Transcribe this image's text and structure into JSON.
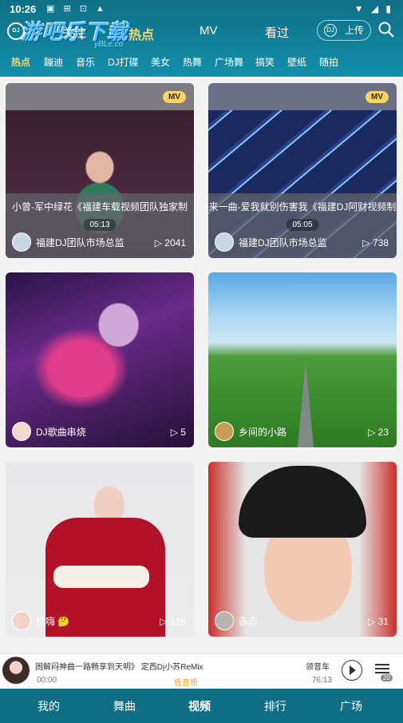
{
  "status_bar": {
    "time": "10:26",
    "icons_left": "▣ ⊞ ⊡ ▲",
    "icons_right": "▼ ◢ ▮"
  },
  "watermark": {
    "main": "游吧乐下载",
    "sub": "yBLe.co"
  },
  "header": {
    "logo": "DJ",
    "tabs": [
      {
        "label": "关注"
      },
      {
        "label": "热点"
      },
      {
        "label": "MV"
      },
      {
        "label": "看过"
      }
    ],
    "upload_label": "上传",
    "upload_icon_text": "DJ",
    "accent_color": "#f5d76e"
  },
  "categories": [
    "热点",
    "蹦迪",
    "音乐",
    "DJ打碟",
    "美女",
    "热舞",
    "广场舞",
    "搞笑",
    "壁纸",
    "随拍"
  ],
  "cards": [
    {
      "badge": "MV",
      "title": "小曾-军中绿花《福建车载视频团队独家制",
      "duration": "05:13",
      "author": "福建DJ团队市场总监",
      "plays": "2041"
    },
    {
      "badge": "MV",
      "title": "来一曲-爱我就别伤害我《福建DJ阿财视频制",
      "duration": "05:05",
      "author": "福建DJ团队市场总监",
      "plays": "738"
    },
    {
      "author": "DJ歌曲串烧",
      "plays": "5"
    },
    {
      "author": "乡间的小路",
      "plays": "23"
    },
    {
      "author": "快嗨 🤔",
      "plays": "128"
    },
    {
      "author": "赤赤",
      "plays": "31"
    }
  ],
  "player": {
    "song": "困解闷神曲一路畅享到天明》 定西Dj小苏ReMix",
    "song_tail": "领音车",
    "elapsed": "00:00",
    "quality": "低音质",
    "total": "76:13",
    "playlist_count": "20"
  },
  "bottom_nav": [
    "我的",
    "舞曲",
    "视频",
    "排行",
    "广场"
  ]
}
